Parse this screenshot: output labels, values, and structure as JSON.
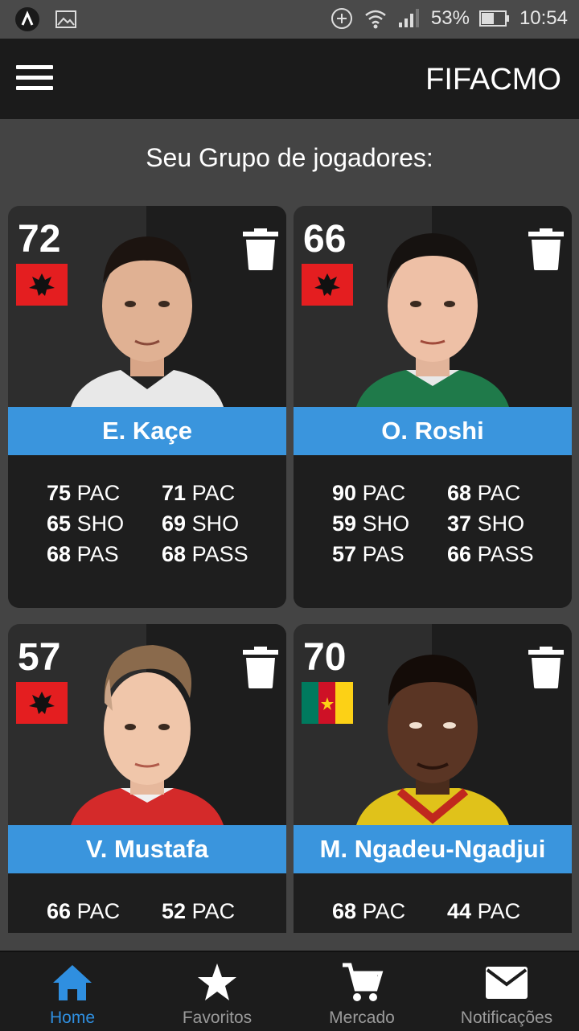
{
  "status_bar": {
    "battery": "53%",
    "time": "10:54"
  },
  "app_bar": {
    "title": "FIFACMO"
  },
  "heading": "Seu Grupo de jogadores:",
  "players": [
    {
      "rating": "72",
      "name": "E. Kaçe",
      "flag": "albania",
      "kit": "#e8e8e8",
      "stats_left": [
        {
          "v": "75",
          "k": "PAC"
        },
        {
          "v": "65",
          "k": "SHO"
        },
        {
          "v": "68",
          "k": "PAS"
        }
      ],
      "stats_right": [
        {
          "v": "71",
          "k": "PAC"
        },
        {
          "v": "69",
          "k": "SHO"
        },
        {
          "v": "68",
          "k": "PASS"
        }
      ]
    },
    {
      "rating": "66",
      "name": "O. Roshi",
      "flag": "albania",
      "kit": "#1f7a4a",
      "stats_left": [
        {
          "v": "90",
          "k": "PAC"
        },
        {
          "v": "59",
          "k": "SHO"
        },
        {
          "v": "57",
          "k": "PAS"
        }
      ],
      "stats_right": [
        {
          "v": "68",
          "k": "PAC"
        },
        {
          "v": "37",
          "k": "SHO"
        },
        {
          "v": "66",
          "k": "PASS"
        }
      ]
    },
    {
      "rating": "57",
      "name": "V. Mustafa",
      "flag": "albania",
      "kit": "#d42a2a",
      "stats_left": [
        {
          "v": "66",
          "k": "PAC"
        }
      ],
      "stats_right": [
        {
          "v": "52",
          "k": "PAC"
        }
      ]
    },
    {
      "rating": "70",
      "name": "M. Ngadeu-Ngadjui",
      "flag": "cameroon",
      "kit": "#e0c21a",
      "stats_left": [
        {
          "v": "68",
          "k": "PAC"
        }
      ],
      "stats_right": [
        {
          "v": "44",
          "k": "PAC"
        }
      ]
    }
  ],
  "bottom_nav": [
    {
      "label": "Home",
      "icon": "home-icon",
      "active": true
    },
    {
      "label": "Favoritos",
      "icon": "star-icon",
      "active": false
    },
    {
      "label": "Mercado",
      "icon": "cart-icon",
      "active": false
    },
    {
      "label": "Notificações",
      "icon": "mail-icon",
      "active": false
    }
  ],
  "colors": {
    "accent": "#3a95dd",
    "nav_active": "#2f8fe0",
    "nav_inactive": "#9a9a9a"
  }
}
